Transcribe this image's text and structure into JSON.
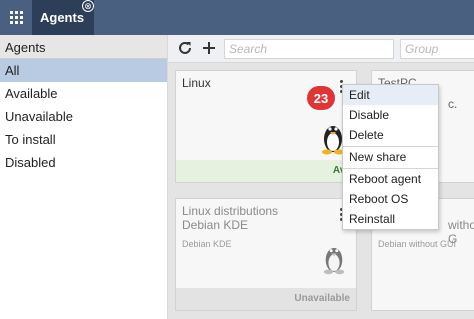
{
  "topbar": {
    "tab_label": "Agents",
    "tab_close_glyph": "⊗"
  },
  "sidebar": {
    "header": "Agents",
    "items": [
      {
        "label": "All",
        "selected": true
      },
      {
        "label": "Available",
        "selected": false
      },
      {
        "label": "Unavailable",
        "selected": false
      },
      {
        "label": "To install",
        "selected": false
      },
      {
        "label": "Disabled",
        "selected": false
      }
    ]
  },
  "toolbar": {
    "search_placeholder": "Search",
    "group_placeholder": "Group"
  },
  "cards": [
    {
      "title": "Linux",
      "subtitle": "",
      "small": "",
      "status": "Availa",
      "status_color": "#2e7d32",
      "status_bg": "#e6f2df",
      "icon": "linux-penguin-icon"
    },
    {
      "title": "TestPC",
      "subtitle": "",
      "small": "",
      "status": "",
      "icon": ""
    },
    {
      "title": "Linux distributions",
      "subtitle": "Debian KDE",
      "small": "Debian KDE",
      "status": "Unavailable",
      "status_color": "#9a9a9a",
      "status_bg": "#e3e3e3",
      "icon": "linux-penguin-icon"
    },
    {
      "title": "Debian",
      "subtitle": "without G",
      "small": "Debian without GUI",
      "status": "",
      "icon": ""
    }
  ],
  "card_partial": {
    "right_top_sub": "c."
  },
  "menu": {
    "items": [
      "Edit",
      "Disable",
      "Delete",
      "New share",
      "Reboot agent",
      "Reboot OS",
      "Reinstall"
    ]
  },
  "badge": "23",
  "colors": {
    "topbar": "#4a6080",
    "active_tab": "#2c3e58",
    "selected_nav": "#b8cbe2",
    "badge": "#e03535"
  }
}
